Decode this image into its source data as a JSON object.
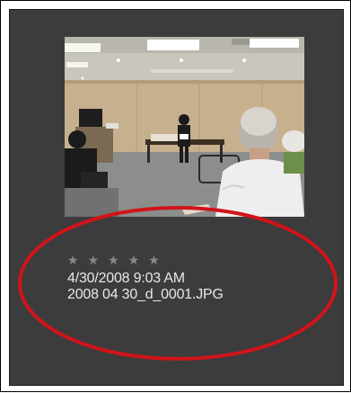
{
  "thumbnail": {
    "image_name": "photo-thumbnail",
    "rating_star_count": 5,
    "rating_filled": 0
  },
  "metadata": {
    "stars": [
      "★",
      "★",
      "★",
      "★",
      "★"
    ],
    "date_taken": "4/30/2008 9:03 AM",
    "file_name": "2008 04 30_d_0001.JPG"
  },
  "colors": {
    "panel_bg": "#3c3c3c",
    "text": "#e8e8e8",
    "star": "#8a8a8a",
    "highlight_ellipse": "#d0141a"
  }
}
